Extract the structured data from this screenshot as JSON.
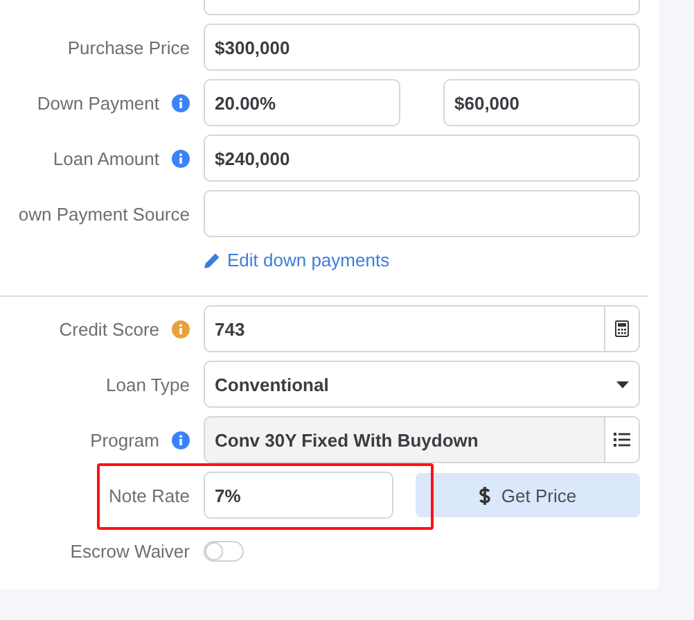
{
  "loan_fields": [
    {
      "kind": "text",
      "label": "Purchase Price",
      "value": "$300,000"
    },
    {
      "kind": "split",
      "label": "Down Payment",
      "info": {
        "color": "#3b82f6"
      },
      "values": [
        "20.00%",
        "$60,000"
      ]
    },
    {
      "kind": "text",
      "label": "Loan Amount",
      "info": {
        "color": "#3b82f6"
      },
      "value": "$240,000"
    },
    {
      "kind": "text",
      "label": "own Payment Source"
    }
  ],
  "edit_link": "Edit down payments",
  "pricing_fields": [
    {
      "kind": "addon",
      "label": "Credit Score",
      "info": {
        "color": "#e6a23c"
      },
      "value": "743",
      "addon": {
        "kind": "calculator"
      },
      "readonly": false
    },
    {
      "kind": "select",
      "label": "Loan Type",
      "value": "Conventional"
    },
    {
      "kind": "addon",
      "label": "Program",
      "info": {
        "color": "#3b82f6"
      },
      "value": "Conv 30Y Fixed With Buydown",
      "addon": {
        "kind": "list"
      },
      "readonly": true
    },
    {
      "kind": "rate",
      "label": "Note Rate",
      "value": "7%",
      "button": "Get Price",
      "highlighted": true
    },
    {
      "kind": "toggle",
      "label": "Escrow Waiver",
      "on": false
    }
  ]
}
